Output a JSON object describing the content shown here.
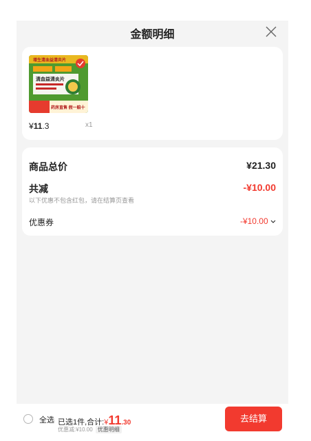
{
  "header": {
    "title": "金额明细",
    "close_icon": "close-icon"
  },
  "product": {
    "image_text_top": "增生清血益清炎片",
    "image_text_name": "清血益清炎片",
    "image_text_bottom": "药房直售 假一赔十",
    "price_symbol": "¥",
    "price_int": "11",
    "price_dec": ".3",
    "quantity": "x1",
    "colors": {
      "image_green": "#4f9a2f",
      "image_orange": "#f2a516",
      "badge_red": "#e63b2e"
    }
  },
  "summary": {
    "goods_total_label": "商品总价",
    "goods_total_value": "¥21.30",
    "discount_label": "共减",
    "discount_value": "-¥10.00",
    "discount_hint": "以下优惠不包含红包，请在结算页查看",
    "coupon_label": "优惠券",
    "coupon_value": "-¥10.00",
    "coupon_chevron_icon": "chevron-down-icon"
  },
  "bottom_bar": {
    "select_all_label": "全选",
    "selected_text": "已选1件,合计:",
    "total_yen": "¥",
    "total_int": "11",
    "total_dec": ".30",
    "discount_line": "优惠减:¥10.00",
    "detail_chip": "优惠明细",
    "checkout_label": "去结算"
  },
  "colors": {
    "accent_red": "#f23a2f",
    "sheet_bg": "#f4f4f4"
  }
}
